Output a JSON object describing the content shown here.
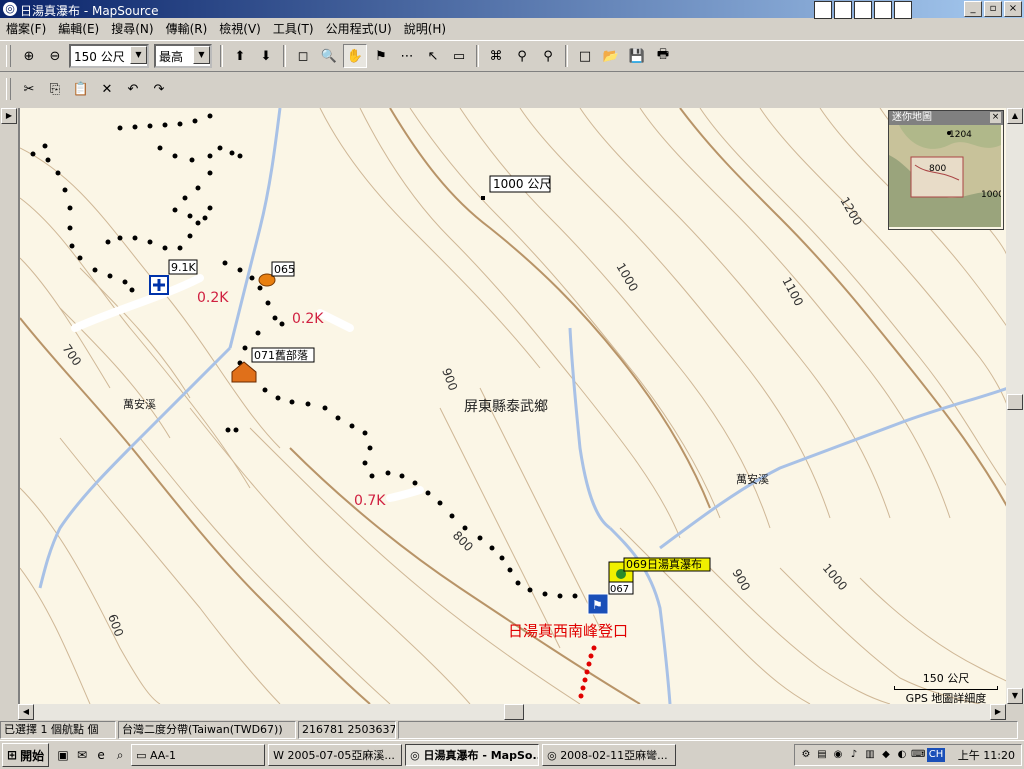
{
  "window": {
    "title": "日湯真瀑布 - MapSource",
    "office_icons": [
      "W",
      "X",
      "P",
      "A",
      "e"
    ],
    "sys_buttons": [
      "_",
      "▫",
      "×"
    ]
  },
  "menu": [
    "檔案(F)",
    "編輯(E)",
    "搜尋(N)",
    "傳輸(R)",
    "檢視(V)",
    "工具(T)",
    "公用程式(U)",
    "說明(H)"
  ],
  "toolbar": {
    "zoom_in": "⊕",
    "zoom_out": "⊖",
    "scale_value": "150 公尺",
    "detail_value": "最高",
    "tools": [
      "⬆",
      "⬇",
      "◻",
      "🔍",
      "✋",
      "⚑",
      "⋯",
      "↖",
      "▭",
      "⌘",
      "⚲",
      "⚲",
      "□",
      "📂",
      "💾",
      "🖶"
    ]
  },
  "edit_toolbar": [
    "✂",
    "⎘",
    "📋",
    "✕",
    "↶",
    "↷"
  ],
  "map": {
    "labels": {
      "peak": "1000 公尺",
      "town": "屏東縣泰武鄉",
      "stream_left": "萬安溪",
      "stream_right": "萬安溪",
      "trailhead": "日湯真西南峰登口",
      "distance_1": "0.2K",
      "distance_2": "0.2K",
      "distance_3": "0.7K",
      "marker_91k": "9.1K",
      "marker_065": "065",
      "marker_071": "071舊部落",
      "marker_069": "069日湯真瀑布",
      "marker_067": "067"
    },
    "contours": [
      "700",
      "900",
      "800",
      "600",
      "900",
      "1000",
      "1100",
      "1200",
      "1000",
      "900",
      "1000"
    ],
    "colors": {
      "background": "#fbf6e6",
      "contour": "#c9ad8a",
      "contour_index": "#b58e63",
      "stream": "#9ab6e0",
      "track": "#000000",
      "route_red": "#e00000"
    }
  },
  "minimap": {
    "title": "迷你地圖",
    "labels": [
      "1204",
      "800",
      "1000",
      "800",
      "900"
    ]
  },
  "scale": {
    "value": "150 公尺",
    "detail_text": "GPS 地圖詳細度"
  },
  "status": {
    "selection": "已選擇 1 個航點 個",
    "datum": "台灣二度分帶(Taiwan(TWD67))",
    "coords": "216781 2503637"
  },
  "taskbar": {
    "start": "開始",
    "tasks": [
      "AA-1",
      "2005-07-05亞麻溪...",
      "日湯真瀑布 - MapSo...",
      "2008-02-11亞麻彎..."
    ],
    "clock": "上午 11:20",
    "tray_lang": "CH"
  }
}
